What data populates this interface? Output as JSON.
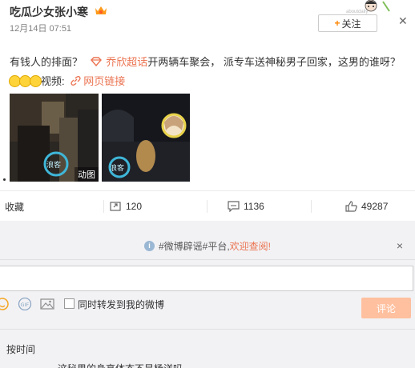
{
  "post": {
    "username": "吃瓜少女张小寒",
    "time": "12月14日 07:51",
    "follow_label": "关注",
    "follow_plus": "+",
    "text_before": "有钱人的排面？",
    "topic": "乔欣超话",
    "text_mid": "开两辆车聚会，  派专车送神秘男子回家，这男的谁呀？",
    "video_label": "视频:",
    "web_link": "网页链接",
    "emoji_count": 3,
    "gif_badge": "动图"
  },
  "actions": {
    "favorite_label": "收藏",
    "repost_count": "120",
    "comment_count": "1136",
    "like_count": "49287"
  },
  "comment_box": {
    "notice_text": "#微博辟谣#平台,",
    "notice_link": "欢迎查阅!",
    "notice_close": "×",
    "repost_checkbox_label": "同时转发到我的微博",
    "submit_label": "评论",
    "gif_label": "GIF",
    "sort_label": "按时间",
    "comment_preview": "这秘男的身高体态不是杨洋吗"
  },
  "colors": {
    "accent_link": "#eb7350",
    "follow_plus": "#ff8200",
    "submit_bg": "#ffc09f"
  }
}
